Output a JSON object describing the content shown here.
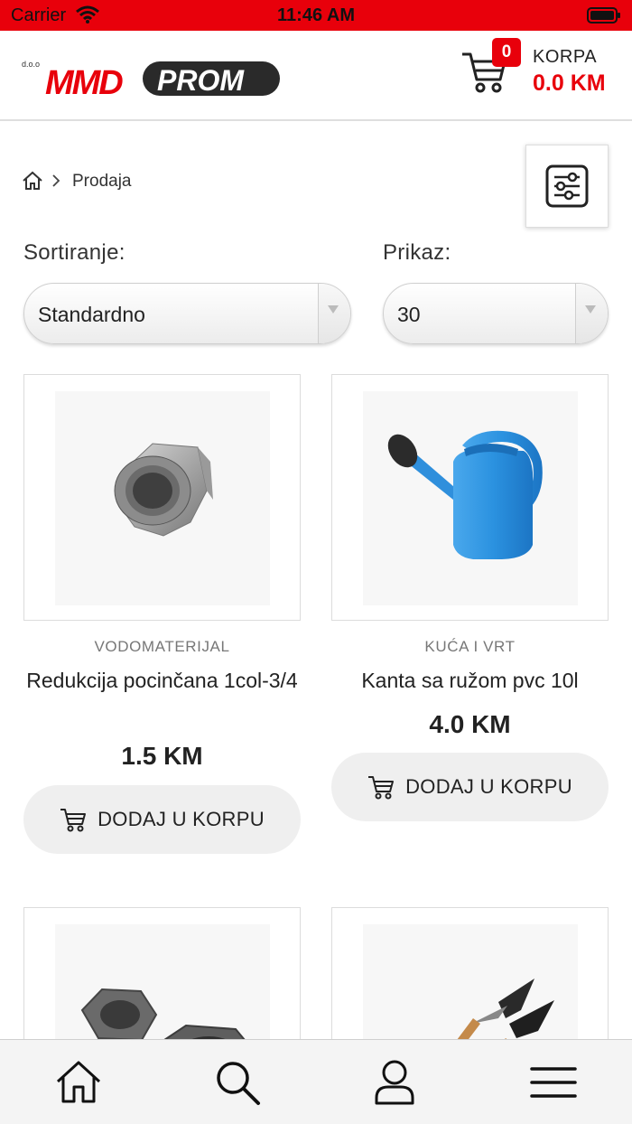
{
  "status_bar": {
    "carrier": "Carrier",
    "time": "11:46 AM"
  },
  "header": {
    "logo": {
      "prefix": "d.o.o",
      "brand_left": "MMD",
      "brand_right": "PROM"
    },
    "cart": {
      "badge": "0",
      "label": "KORPA",
      "total": "0.0 KM"
    }
  },
  "breadcrumb": {
    "current": "Prodaja"
  },
  "sort": {
    "label": "Sortiranje:",
    "selected": "Standardno"
  },
  "view": {
    "label": "Prikaz:",
    "selected": "30"
  },
  "products": [
    {
      "category": "VODOMATERIJAL",
      "name": "Redukcija pocinčana 1col-3/4",
      "price": "1.5 KM",
      "button": "DODAJ U KORPU"
    },
    {
      "category": "KUĆA I VRT",
      "name": "Kanta sa ružom pvc 10l",
      "price": "4.0 KM",
      "button": "DODAJ U KORPU"
    }
  ],
  "colors": {
    "accent": "#e8000b",
    "text": "#222222",
    "button_bg": "#efefef",
    "nav_bg": "#f4f4f4"
  },
  "icons": {
    "status": [
      "wifi-icon",
      "battery-icon"
    ],
    "header": [
      "cart-icon"
    ],
    "filter": "sliders-icon",
    "nav": [
      "home-icon",
      "search-icon",
      "user-icon",
      "menu-icon"
    ]
  }
}
